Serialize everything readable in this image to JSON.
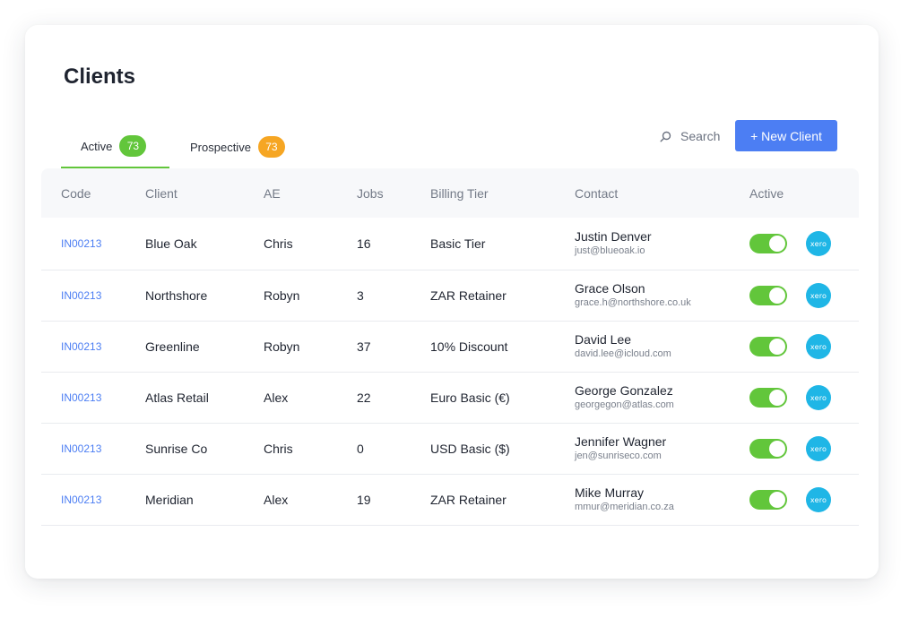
{
  "page": {
    "title": "Clients"
  },
  "tabs": [
    {
      "label": "Active",
      "count": "73",
      "color": "#62c63b"
    },
    {
      "label": "Prospective",
      "count": "73",
      "color": "#f6a623"
    }
  ],
  "search": {
    "label": "Search",
    "icon": "search-icon"
  },
  "new_client_label": "+ New Client",
  "columns": [
    "Code",
    "Client",
    "AE",
    "Jobs",
    "Billing Tier",
    "Contact",
    "Active"
  ],
  "rows": [
    {
      "code": "IN00213",
      "client": "Blue Oak",
      "ae": "Chris",
      "jobs": "16",
      "tier": "Basic Tier",
      "contact_name": "Justin Denver",
      "contact_email": "just@blueoak.io",
      "active": true,
      "integration": "xero"
    },
    {
      "code": "IN00213",
      "client": "Northshore",
      "ae": "Robyn",
      "jobs": "3",
      "tier": "ZAR Retainer",
      "contact_name": "Grace Olson",
      "contact_email": "grace.h@northshore.co.uk",
      "active": true,
      "integration": "xero"
    },
    {
      "code": "IN00213",
      "client": "Greenline",
      "ae": "Robyn",
      "jobs": "37",
      "tier": "10% Discount",
      "contact_name": "David Lee",
      "contact_email": "david.lee@icloud.com",
      "active": true,
      "integration": "xero"
    },
    {
      "code": "IN00213",
      "client": "Atlas Retail",
      "ae": "Alex",
      "jobs": "22",
      "tier": "Euro Basic (€)",
      "contact_name": "George Gonzalez",
      "contact_email": "georgegon@atlas.com",
      "active": true,
      "integration": "xero"
    },
    {
      "code": "IN00213",
      "client": "Sunrise Co",
      "ae": "Chris",
      "jobs": "0",
      "tier": "USD Basic ($)",
      "contact_name": "Jennifer Wagner",
      "contact_email": "jen@sunriseco.com",
      "active": true,
      "integration": "xero"
    },
    {
      "code": "IN00213",
      "client": "Meridian",
      "ae": "Alex",
      "jobs": "19",
      "tier": "ZAR Retainer",
      "contact_name": "Mike Murray",
      "contact_email": "mmur@meridian.co.za",
      "active": true,
      "integration": "xero"
    }
  ],
  "colors": {
    "accent": "#4c7ef3",
    "toggle_on": "#62c63b",
    "xero": "#1fb6e6"
  }
}
